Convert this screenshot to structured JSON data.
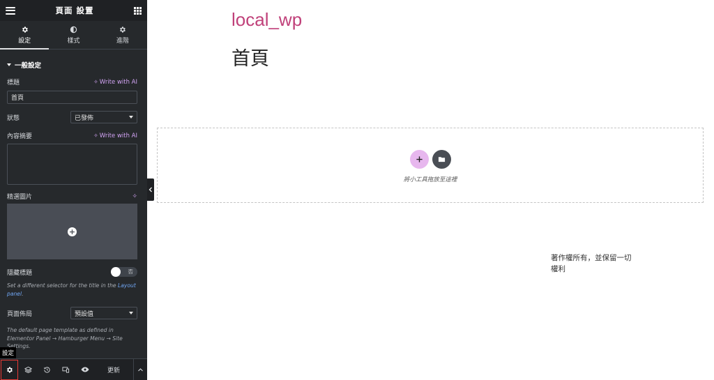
{
  "sidebar": {
    "header_title": "頁面 設置",
    "tabs": [
      {
        "label": "設定",
        "icon": "gear-icon",
        "active": true
      },
      {
        "label": "樣式",
        "icon": "contrast-icon",
        "active": false
      },
      {
        "label": "進階",
        "icon": "gear-icon",
        "active": false
      }
    ],
    "section_title": "一般設定",
    "title_field": {
      "label": "標題",
      "ai_label": "Write with AI",
      "value": "首頁"
    },
    "status_field": {
      "label": "狀態",
      "value": "已發佈"
    },
    "excerpt_field": {
      "label": "內容摘要",
      "ai_label": "Write with AI"
    },
    "featured_image": {
      "label": "精選圖片"
    },
    "hide_title": {
      "label": "隱藏標題",
      "toggle_text": "否"
    },
    "hide_title_note": {
      "text": "Set a different selector for the title in the ",
      "link": "Layout panel",
      "end": "."
    },
    "page_layout": {
      "label": "頁面佈局",
      "value": "預設值"
    },
    "layout_note": "The default page template as defined in Elementor Panel → Hamburger Menu → Site Settings.",
    "footer": {
      "tooltip": "設定",
      "update_label": "更新",
      "icons": [
        "gear-icon",
        "layers-icon",
        "history-icon",
        "responsive-icon",
        "eye-icon"
      ]
    }
  },
  "canvas": {
    "site_title": "local_wp",
    "page_title": "首頁",
    "drop_text": "將小工具拖放至這裡",
    "copyright": "著作權所有，並保留一切權利"
  },
  "colors": {
    "sidebar_bg": "#26292c",
    "accent_ai": "#d1a3f3",
    "site_title": "#c0417a",
    "add_button": "#e7b7ee",
    "highlight": "#e53935"
  }
}
